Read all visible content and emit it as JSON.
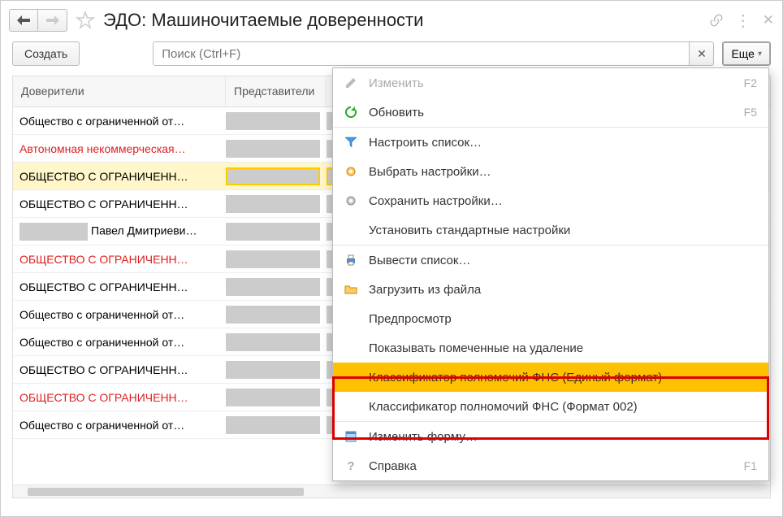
{
  "title": "ЭДО: Машиночитаемые доверенности",
  "toolbar": {
    "create": "Создать",
    "more": "Еще"
  },
  "search": {
    "placeholder": "Поиск (Ctrl+F)"
  },
  "columns": {
    "col1": "Доверители",
    "col2": "Представители"
  },
  "rows": [
    {
      "text": "Общество с ограниченной от…",
      "red": false,
      "selected": false,
      "lead": false
    },
    {
      "text": "Автономная некоммерческая…",
      "red": true,
      "selected": false,
      "lead": false
    },
    {
      "text": "ОБЩЕСТВО С ОГРАНИЧЕНН…",
      "red": false,
      "selected": true,
      "lead": false
    },
    {
      "text": "ОБЩЕСТВО С ОГРАНИЧЕНН…",
      "red": false,
      "selected": false,
      "lead": false
    },
    {
      "text": "Павел Дмитриеви…",
      "red": false,
      "selected": false,
      "lead": true
    },
    {
      "text": "ОБЩЕСТВО С ОГРАНИЧЕНН…",
      "red": true,
      "selected": false,
      "lead": false
    },
    {
      "text": "ОБЩЕСТВО С ОГРАНИЧЕНН…",
      "red": false,
      "selected": false,
      "lead": false
    },
    {
      "text": "Общество с ограниченной от…",
      "red": false,
      "selected": false,
      "lead": false
    },
    {
      "text": "Общество с ограниченной от…",
      "red": false,
      "selected": false,
      "lead": false
    },
    {
      "text": "ОБЩЕСТВО С ОГРАНИЧЕНН…",
      "red": false,
      "selected": false,
      "lead": false
    },
    {
      "text": "ОБЩЕСТВО С ОГРАНИЧЕНН…",
      "red": true,
      "selected": false,
      "lead": false
    },
    {
      "text": "Общество с ограниченной от…",
      "red": false,
      "selected": false,
      "lead": false
    }
  ],
  "menu": [
    {
      "icon": "pencil-icon",
      "label": "Изменить",
      "shortcut": "F2",
      "disabled": true
    },
    {
      "icon": "refresh-icon",
      "label": "Обновить",
      "shortcut": "F5",
      "disabled": false
    },
    {
      "sep": true
    },
    {
      "icon": "filter-icon",
      "label": "Настроить список…",
      "shortcut": "",
      "disabled": false
    },
    {
      "icon": "gear-open-icon",
      "label": "Выбрать настройки…",
      "shortcut": "",
      "disabled": false
    },
    {
      "icon": "gear-save-icon",
      "label": "Сохранить настройки…",
      "shortcut": "",
      "disabled": false
    },
    {
      "icon": "",
      "label": "Установить стандартные настройки",
      "shortcut": "",
      "disabled": false
    },
    {
      "sep": true
    },
    {
      "icon": "print-icon",
      "label": "Вывести список…",
      "shortcut": "",
      "disabled": false
    },
    {
      "icon": "folder-icon",
      "label": "Загрузить из файла",
      "shortcut": "",
      "disabled": false
    },
    {
      "icon": "",
      "label": "Предпросмотр",
      "shortcut": "",
      "disabled": false
    },
    {
      "icon": "",
      "label": "Показывать помеченные на удаление",
      "shortcut": "",
      "disabled": false
    },
    {
      "icon": "",
      "label": "Классификатор полномочий ФНС (Единый формат)",
      "shortcut": "",
      "disabled": false,
      "hover": true
    },
    {
      "icon": "",
      "label": "Классификатор полномочий ФНС (Формат 002)",
      "shortcut": "",
      "disabled": false
    },
    {
      "sep": true
    },
    {
      "icon": "form-icon",
      "label": "Изменить форму…",
      "shortcut": "",
      "disabled": false
    },
    {
      "icon": "help-icon",
      "label": "Справка",
      "shortcut": "F1",
      "disabled": false
    }
  ]
}
